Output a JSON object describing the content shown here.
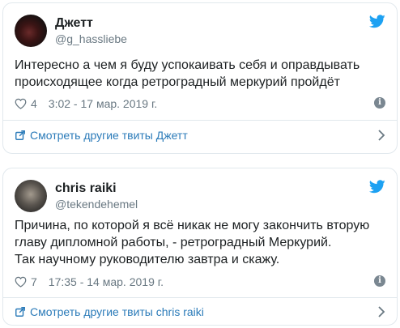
{
  "colors": {
    "text": "#1c2022",
    "muted": "#697882",
    "link": "#2b7bb9",
    "twitter_blue": "#1da1f2",
    "border": "#e1e8ed"
  },
  "tweets": [
    {
      "display_name": "Джетт",
      "handle": "@g_hassliebe",
      "text": "Интересно а чем я буду успокаивать себя и оправдывать\nпроисходящее когда ретроградный меркурий пройдёт",
      "likes": "4",
      "timestamp": "3:02 - 17 мар. 2019 г.",
      "more_link": "Смотреть другие твиты Джетт",
      "icons": {
        "like": "heart-icon",
        "info": "info-icon",
        "brand": "twitter-bird-icon",
        "more": "external-link-icon",
        "chevron": "chevron-right-icon"
      }
    },
    {
      "display_name": "chris raiki",
      "handle": "@tekendehemel",
      "text": "Причина, по которой я всё никак не могу закончить вторую\nглаву дипломной работы, - ретроградный Меркурий.\nТак научному руководителю завтра и скажу.",
      "likes": "7",
      "timestamp": "17:35 - 14 мар. 2019 г.",
      "more_link": "Смотреть другие твиты chris raiki",
      "icons": {
        "like": "heart-icon",
        "info": "info-icon",
        "brand": "twitter-bird-icon",
        "more": "external-link-icon",
        "chevron": "chevron-right-icon"
      }
    }
  ]
}
